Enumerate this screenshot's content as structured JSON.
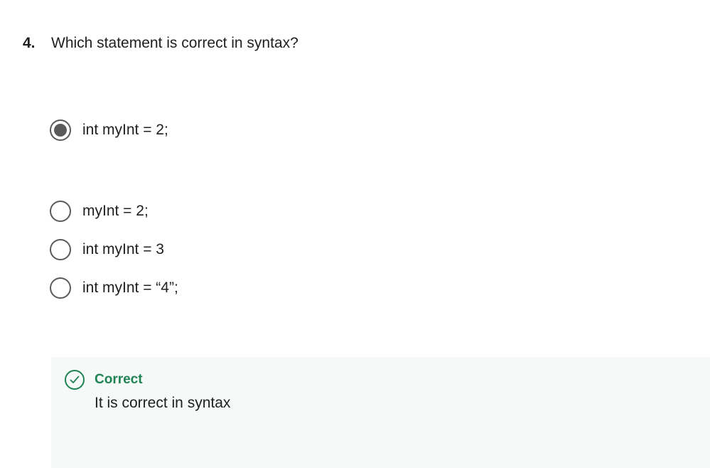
{
  "question": {
    "number": "4.",
    "text": "Which statement is correct in syntax?"
  },
  "options": [
    {
      "label": "int myInt = 2;",
      "selected": true
    },
    {
      "label": "myInt = 2;",
      "selected": false
    },
    {
      "label": "int myInt = 3",
      "selected": false
    },
    {
      "label": "int myInt = “4”;",
      "selected": false
    }
  ],
  "feedback": {
    "icon": "check-circle-icon",
    "title": "Correct",
    "text": "It is correct in syntax",
    "accent_color": "#1f8354",
    "background_color": "#f5f9f7"
  },
  "colors": {
    "radio": "#5b5b5b",
    "text": "#1f1f1f"
  }
}
